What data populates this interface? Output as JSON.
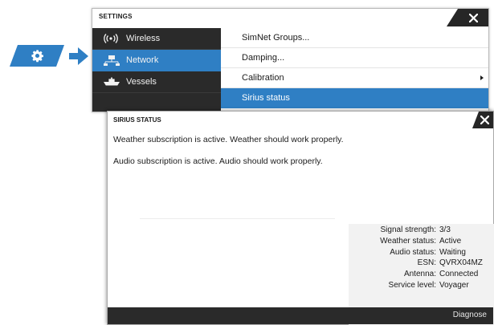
{
  "colors": {
    "accent": "#2f7fc4",
    "dark": "#2a2a2a",
    "text": "#1b1b1b"
  },
  "launcher": {
    "icon": "gear-icon",
    "arrow_icon": "arrow-right-icon"
  },
  "settings": {
    "title": "SETTINGS",
    "close_icon": "close-icon",
    "categories": [
      {
        "label": "Wireless",
        "icon": "wireless-icon",
        "active": false
      },
      {
        "label": "Network",
        "icon": "network-icon",
        "active": true
      },
      {
        "label": "Vessels",
        "icon": "vessels-icon",
        "active": false
      }
    ],
    "options": [
      {
        "label": "SimNet Groups..."
      },
      {
        "label": "Damping..."
      },
      {
        "label": "Calibration",
        "has_submenu": true
      },
      {
        "label": "Sirius status",
        "selected": true
      }
    ]
  },
  "dialog": {
    "title": "SIRIUS STATUS",
    "close_icon": "close-icon",
    "messages": [
      "Weather subscription is active. Weather should work properly.",
      "Audio subscription is active. Audio should work properly."
    ],
    "status": [
      {
        "label": "Signal strength:",
        "value": "3/3"
      },
      {
        "label": "Weather status:",
        "value": "Active"
      },
      {
        "label": "Audio status:",
        "value": "Waiting"
      },
      {
        "label": "ESN:",
        "value": "QVRX04MZ"
      },
      {
        "label": "Antenna:",
        "value": "Connected"
      },
      {
        "label": "Service level:",
        "value": "Voyager"
      }
    ],
    "footer_button": "Diagnose"
  }
}
